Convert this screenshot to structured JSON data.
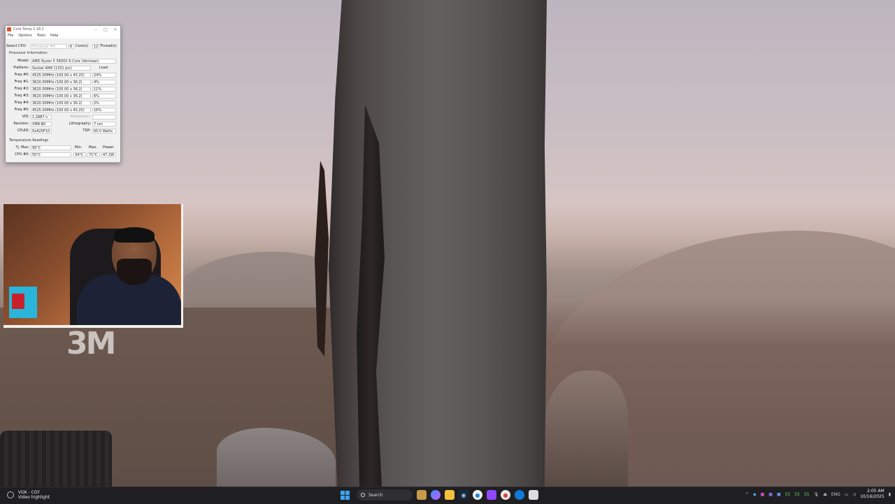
{
  "coretemp": {
    "title": "Core Temp 1.18.1",
    "menu": [
      "File",
      "Options",
      "Tools",
      "Help"
    ],
    "select_cpu_label": "Select CPU:",
    "select_cpu_value": "Processor #0",
    "cores_count": "6",
    "cores_label": "Core(s)",
    "threads_count": "12",
    "threads_label": "Thread(s)",
    "processor_section": "Processor Information",
    "model_label": "Model:",
    "model_value": "AMD Ryzen 5 5600X 6-Core (Vermeer)",
    "platform_label": "Platform:",
    "platform_value": "Socket AM4 (1331 pin)",
    "load_header": "Load",
    "freqs": [
      {
        "label": "Freq #0:",
        "value": "4525.00MHz (100.00 x 45.25)",
        "load": "24%"
      },
      {
        "label": "Freq #1:",
        "value": "3620.00MHz (100.00 x 36.2)",
        "load": "4%"
      },
      {
        "label": "Freq #2:",
        "value": "3620.00MHz (100.00 x 36.2)",
        "load": "11%"
      },
      {
        "label": "Freq #3:",
        "value": "3620.00MHz (100.00 x 36.2)",
        "load": "6%"
      },
      {
        "label": "Freq #4:",
        "value": "3620.00MHz (100.00 x 36.2)",
        "load": "2%"
      },
      {
        "label": "Freq #5:",
        "value": "4525.00MHz (100.00 x 45.25)",
        "load": "16%"
      }
    ],
    "vid_label": "VID:",
    "vid_value": "1.2687 v",
    "modulation_label": "Modulation:",
    "revision_label": "Revision:",
    "revision_value": "VMR-B0",
    "lithography_label": "Lithography:",
    "lithography_value": "7 nm",
    "cpuid_label": "CPUID:",
    "cpuid_value": "0xA20F10",
    "tdp_label": "TDP:",
    "tdp_value": "65.0 Watts",
    "temp_section": "Temperature Readings",
    "tjmax_label": "Tj. Max:",
    "tjmax_value": "95°C",
    "min_header": "Min.",
    "max_header": "Max.",
    "power_header": "Power:",
    "cpu0_label": "CPU #0:",
    "cpu0_value": "55°C",
    "cpu0_min": "34°C",
    "cpu0_max": "71°C",
    "cpu0_power": "47.2W"
  },
  "overlay": {
    "logo_text": "3M"
  },
  "taskbar": {
    "widget_line1": "VGK - CGY",
    "widget_line2": "Video highlight",
    "search_label": "Search",
    "lang": "ENG",
    "time": "2:05 AM",
    "date": "10/16/2025",
    "tray_numbers": [
      "55",
      "55",
      "55"
    ],
    "colors": {
      "accent": "#3ca3f0",
      "taskbar": "#1f1f22"
    }
  }
}
